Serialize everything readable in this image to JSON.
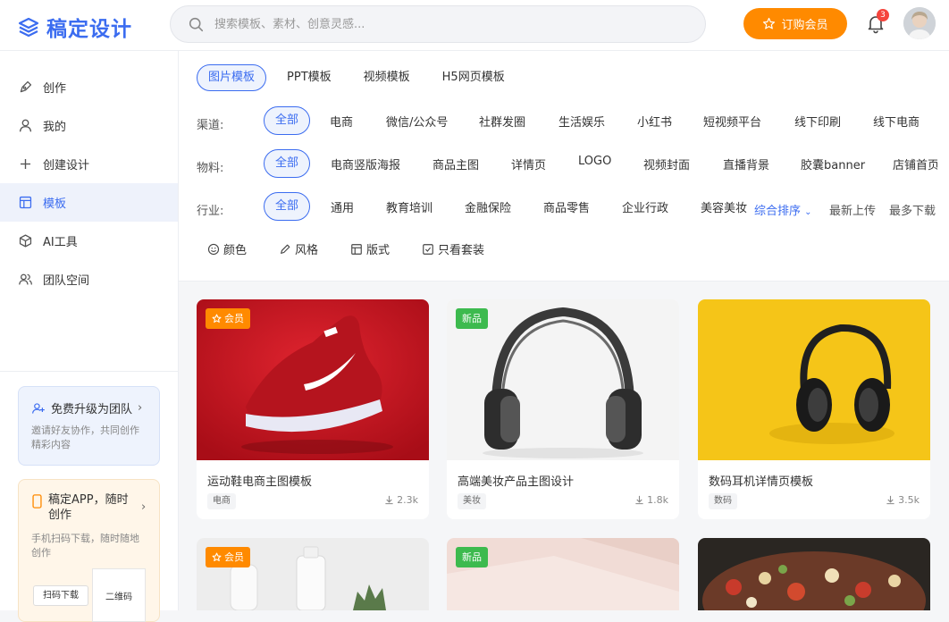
{
  "brand": {
    "name": "稿定设计"
  },
  "search": {
    "placeholder": "搜索模板、素材、创意灵感..."
  },
  "header": {
    "vip_label": "订购会员",
    "notification_count": "3"
  },
  "sidebar": {
    "items": [
      {
        "label": "创作",
        "icon": "pen-icon"
      },
      {
        "label": "我的",
        "icon": "user-icon"
      },
      {
        "label": "创建设计",
        "icon": "plus-icon"
      },
      {
        "label": "模板",
        "icon": "template-icon"
      },
      {
        "label": "AI工具",
        "icon": "cube-icon"
      },
      {
        "label": "团队空间",
        "icon": "team-icon"
      }
    ],
    "team_card": {
      "title": "免费升级为团队",
      "desc": "邀请好友协作，共同创作精彩内容"
    },
    "app_card": {
      "title": "稿定APP，随时创作",
      "desc": "手机扫码下载，随时随地创作",
      "scan_label": "扫码下载",
      "qr_label": "二维码"
    }
  },
  "filter": {
    "tabs": [
      "图片模板",
      "PPT模板",
      "视频模板",
      "H5网页模板"
    ],
    "channel_label": "渠道:",
    "channels": [
      "全部",
      "电商",
      "微信/公众号",
      "社群发圈",
      "生活娱乐",
      "小红书",
      "短视频平台",
      "线下印刷",
      "线下电商"
    ],
    "material_label": "物料:",
    "materials": [
      "全部",
      "电商竖版海报",
      "商品主图",
      "详情页",
      "LOGO",
      "视频封面",
      "直播背景",
      "胶囊banner",
      "店铺首页"
    ],
    "industry_label": "行业:",
    "industries": [
      "全部",
      "通用",
      "教育培训",
      "金融保险",
      "商品零售",
      "企业行政",
      "美容美妆"
    ],
    "sort": [
      "综合排序",
      "最新上传",
      "最多下载"
    ],
    "tools": [
      "颜色",
      "风格",
      "版式",
      "只看套装"
    ]
  },
  "cards": [
    {
      "badge": "会员",
      "title": "运动鞋电商主图模板",
      "tag": "电商",
      "downloads": "2.3k"
    },
    {
      "badge": "新品",
      "title": "高端美妆产品主图设计",
      "tag": "美妆",
      "downloads": "1.8k"
    },
    {
      "badge": "",
      "title": "数码耳机详情页模板",
      "tag": "数码",
      "downloads": "3.5k"
    },
    {
      "badge": "会员"
    },
    {
      "badge": "新品"
    },
    {
      "badge": ""
    }
  ],
  "colors": {
    "accent": "#3b6cf0",
    "vip": "#ff8a00",
    "new": "#3dba4e"
  }
}
